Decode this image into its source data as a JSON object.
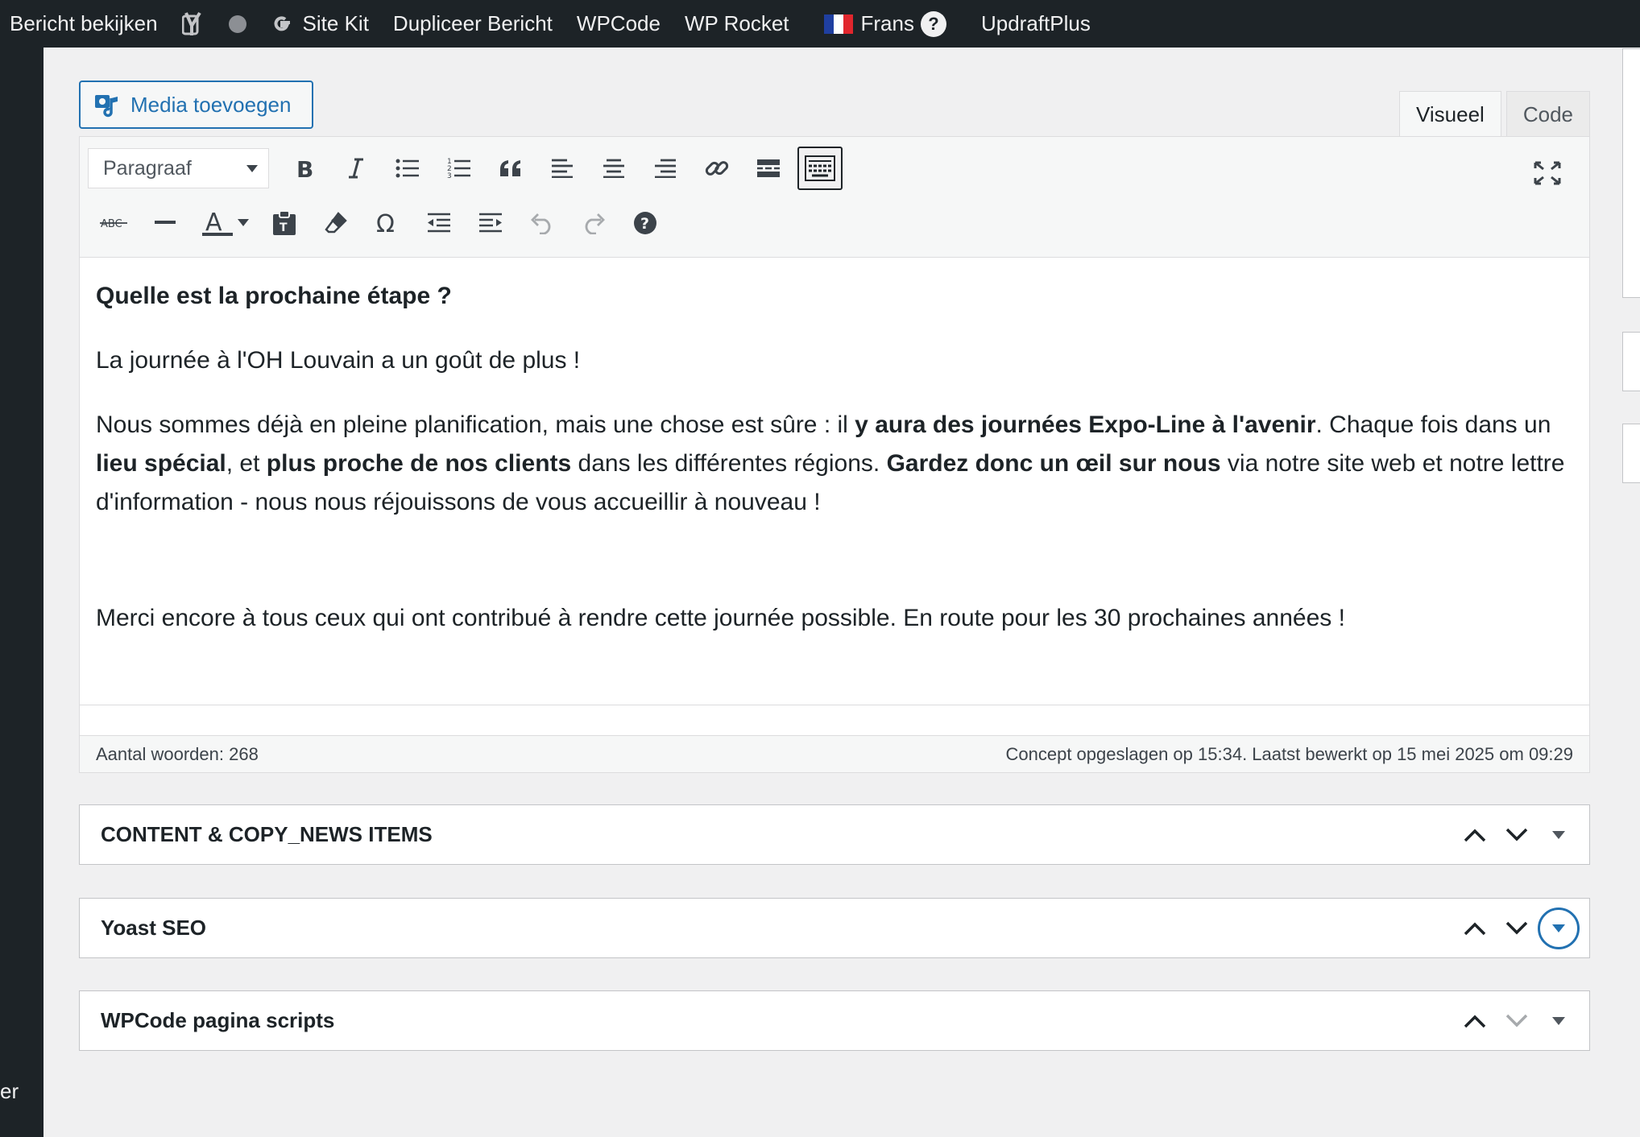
{
  "admin_bar": {
    "view_post": "Bericht bekijken",
    "site_kit": "Site Kit",
    "duplicate": "Dupliceer Bericht",
    "wpcode": "WPCode",
    "wp_rocket": "WP Rocket",
    "language": "Frans",
    "help": "?",
    "updraft": "UpdraftPlus"
  },
  "admin_menu": {
    "fragment": "er"
  },
  "editor": {
    "media_button": "Media toevoegen",
    "tabs": [
      {
        "label": "Visueel",
        "active": true
      },
      {
        "label": "Code",
        "active": false
      }
    ],
    "format_select": "Paragraaf",
    "toolbar_icons_row1": [
      "bold-icon",
      "italic-icon",
      "bulleted-list-icon",
      "numbered-list-icon",
      "blockquote-icon",
      "align-left-icon",
      "align-center-icon",
      "align-right-icon",
      "link-icon",
      "read-more-icon",
      "toolbar-toggle-icon"
    ],
    "toolbar_icons_row2": [
      "strikethrough-icon",
      "horizontal-line-icon",
      "text-color-icon",
      "paste-text-icon",
      "clear-formatting-icon",
      "special-character-icon",
      "outdent-icon",
      "indent-icon",
      "undo-icon",
      "redo-icon",
      "keyboard-shortcuts-icon"
    ],
    "content": {
      "heading": "Quelle est la prochaine étape ?",
      "p1": "La journée à l'OH Louvain a un goût de plus !",
      "p2": {
        "s1": "Nous sommes déjà en pleine planification, mais une chose est sûre : il ",
        "b1": "y aura des journées Expo-Line à l'avenir",
        "s2": ". Chaque fois dans un ",
        "b2": "lieu spécial",
        "s3": ", et ",
        "b3": "plus proche de nos clients",
        "s4": " dans les différentes régions. ",
        "b4": "Gardez donc un œil sur nous",
        "s5": " via notre site web et notre lettre d'information - nous nous réjouissons de vous accueillir à nouveau !"
      },
      "p3": "Merci encore à tous ceux qui ont contribué à rendre cette journée possible. En route pour les 30 prochaines années !"
    },
    "word_count": "Aantal woorden: 268",
    "save_status": "Concept opgeslagen op 15:34. Laatst bewerkt op 15 mei 2025 om 09:29"
  },
  "metaboxes": [
    {
      "title": "CONTENT & COPY_NEWS ITEMS"
    },
    {
      "title": "Yoast SEO"
    },
    {
      "title": "WPCode pagina scripts"
    }
  ],
  "colors": {
    "admin_dark": "#1d2327",
    "accent_blue": "#2271b1",
    "background": "#f0f0f1"
  }
}
